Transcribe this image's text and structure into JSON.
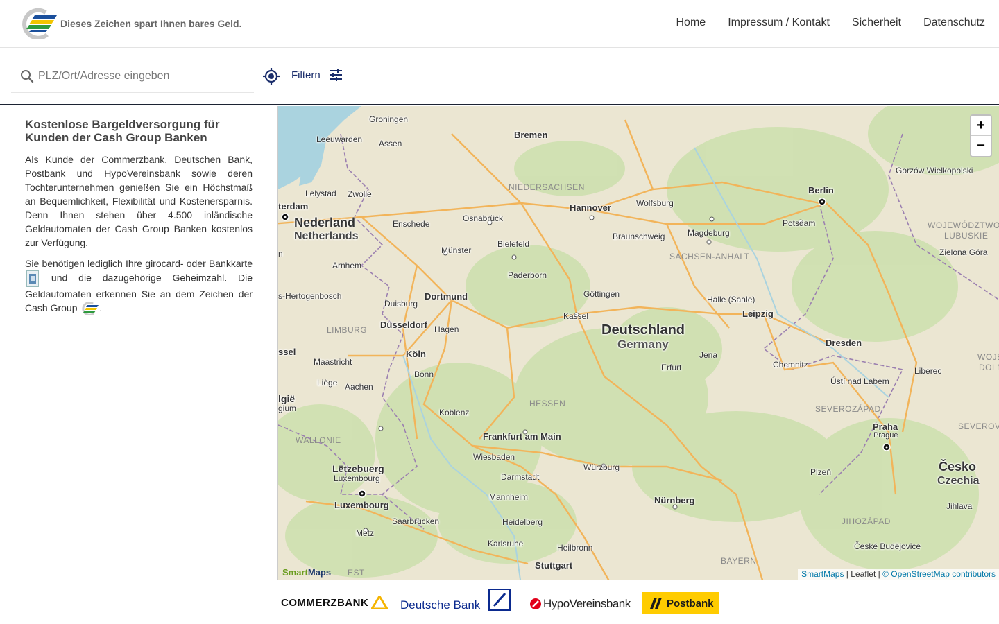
{
  "header": {
    "tagline": "Dieses Zeichen spart Ihnen bares Geld.",
    "nav": [
      "Home",
      "Impressum / Kontakt",
      "Sicherheit",
      "Datenschutz"
    ]
  },
  "search": {
    "placeholder": "PLZ/Ort/Adresse eingeben",
    "filter_label": "Filtern"
  },
  "sidebar": {
    "title": "Kostenlose Bargeldversorgung für Kunden der Cash Group Banken",
    "paragraph1": "Als Kunde der Commerzbank, Deutschen Bank, Postbank und HypoVereinsbank sowie deren Tochterunternehmen genießen Sie ein Höchstmaß an Bequemlichkeit, Flexibilität und Kostenersparnis. Denn Ihnen stehen über 4.500 inländische Geldautomaten der Cash Group Banken kostenlos zur Verfügung.",
    "paragraph2_a": "Sie benötigen lediglich Ihre girocard- oder Bankkarte",
    "paragraph2_b": "und die dazugehörige Geheimzahl. Die Geldautomaten erkennen Sie an dem Zeichen der Cash Group",
    "paragraph2_c": "."
  },
  "map": {
    "countries": {
      "de": "Deutschland",
      "de_en": "Germany",
      "nl": "Nederland",
      "nl_en": "Netherlands",
      "cz": "Česko",
      "cz_en": "Czechia",
      "lu": "Lëtzebuerg",
      "lu_en": "Luxembourg",
      "be": "lgië",
      "be_2": "gium"
    },
    "cities": {
      "groningen": "Groningen",
      "leeuwarden": "Leeuwarden",
      "assen": "Assen",
      "bremen": "Bremen",
      "lelystad": "Lelystad",
      "zwolle": "Zwolle",
      "amsterdam": "terdam",
      "enschede": "Enschede",
      "osnabrueck": "Osnabrück",
      "hannover": "Hannover",
      "wolfsburg": "Wolfsburg",
      "berlin": "Berlin",
      "potsdam": "Potsdam",
      "magdeburg": "Magdeburg",
      "braunschweig": "Braunschweig",
      "bielefeld": "Bielefeld",
      "muenster": "Münster",
      "arnhem": "Arnhem",
      "paderborn": "Paderborn",
      "hertogenbosch": "s-Hertogenbosch",
      "duisburg": "Duisburg",
      "dortmund": "Dortmund",
      "goettingen": "Göttingen",
      "halle": "Halle (Saale)",
      "leipzig": "Leipzig",
      "kassel": "Kassel",
      "duesseldorf": "Düsseldorf",
      "hagen": "Hagen",
      "dresden": "Dresden",
      "koeln": "Köln",
      "bonn": "Bonn",
      "jena": "Jena",
      "erfurt": "Erfurt",
      "chemnitz": "Chemnitz",
      "maastricht": "Maastricht",
      "liege": "Liège",
      "aachen": "Aachen",
      "usti": "Ústí nad Labem",
      "liberec": "Liberec",
      "koblenz": "Koblenz",
      "frankfurt": "Frankfurt am Main",
      "praha": "Praha",
      "prague": "Prague",
      "wiesbaden": "Wiesbaden",
      "wuerzburg": "Würzburg",
      "darmstadt": "Darmstadt",
      "plzen": "Plzeň",
      "mannheim": "Mannheim",
      "nuernberg": "Nürnberg",
      "luxembourg": "Luxembourg",
      "heidelberg": "Heidelberg",
      "saarbruecken": "Saarbrücken",
      "jihlava": "Jihlava",
      "metz": "Metz",
      "karlsruhe": "Karlsruhe",
      "heilbronn": "Heilbronn",
      "budejovice": "České Budějovice",
      "stuttgart": "Stuttgart",
      "gorzow": "Gorzów Wielkopolski",
      "zielona": "Zielona Góra",
      "sel": "ssel",
      "n": "n",
      "est": "EST"
    },
    "regions": {
      "niedersachsen": "NIEDERSACHSEN",
      "sachsen_anhalt": "SACHSEN-ANHALT",
      "limburg": "LIMBURG",
      "hessen": "HESSEN",
      "wallonie": "WALLONIE",
      "severozapad": "SEVEROZÁPAD",
      "severovych": "SEVEROVÝCH",
      "jihozapad": "JIHOZÁPAD",
      "bayern": "BAYERN",
      "lubuskie1": "WOJEWÓDZTWO",
      "lubuskie2": "LUBUSKIE",
      "wojew": "WOJE",
      "dolno": "DOLN"
    },
    "zoom_in": "+",
    "zoom_out": "−",
    "attribution_smartmaps": "SmartMaps",
    "attribution_leaflet": "Leaflet",
    "attribution_osm": "© OpenStreetMap contributors",
    "brand_a": "Smart",
    "brand_b": "Maps"
  },
  "footer": {
    "banks": [
      "COMMERZBANK",
      "Deutsche Bank",
      "HypoVereinsbank",
      "Postbank"
    ]
  }
}
